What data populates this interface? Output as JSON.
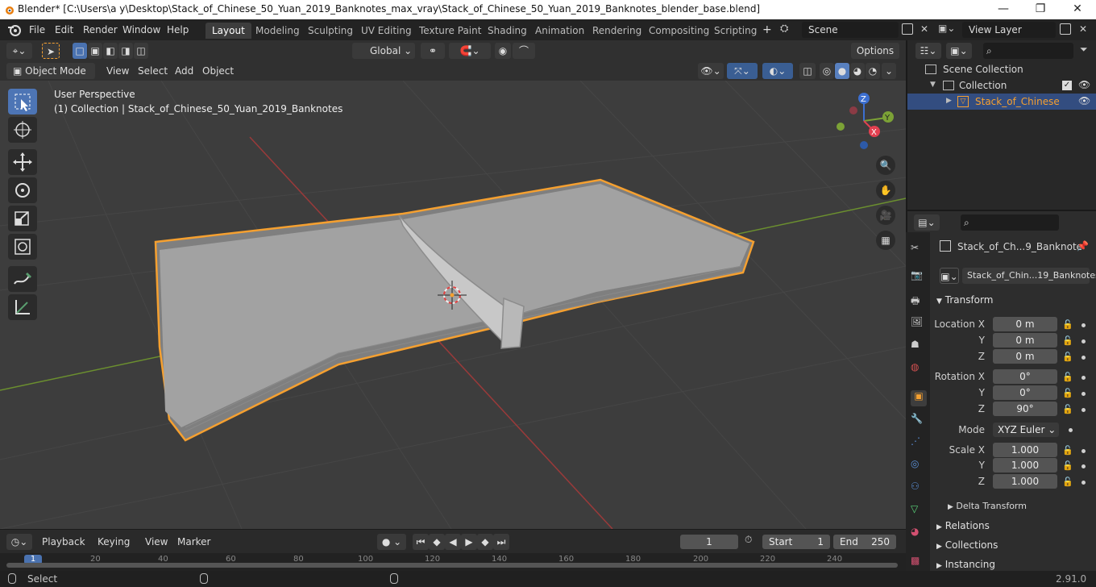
{
  "titlebar": {
    "title": "Blender* [C:\\Users\\a y\\Desktop\\Stack_of_Chinese_50_Yuan_2019_Banknotes_max_vray\\Stack_of_Chinese_50_Yuan_2019_Banknotes_blender_base.blend]",
    "minimize": "—",
    "maximize": "❐",
    "close": "✕"
  },
  "menubar": {
    "menus": [
      "File",
      "Edit",
      "Render",
      "Window",
      "Help"
    ],
    "workspaces": [
      "Layout",
      "Modeling",
      "Sculpting",
      "UV Editing",
      "Texture Paint",
      "Shading",
      "Animation",
      "Rendering",
      "Compositing",
      "Scripting"
    ],
    "add_workspace": "+",
    "scene": "Scene",
    "view_layer": "View Layer"
  },
  "viewport_header": {
    "orientation": "Global",
    "options": "Options",
    "mode": "Object Mode",
    "menus": [
      "View",
      "Select",
      "Add",
      "Object"
    ]
  },
  "viewport": {
    "perspective": "User Perspective",
    "collection_info": "(1) Collection | Stack_of_Chinese_50_Yuan_2019_Banknotes",
    "gizmo": {
      "x": "X",
      "y": "Y",
      "z": "Z"
    }
  },
  "outliner": {
    "scene_collection": "Scene Collection",
    "collection": "Collection",
    "object": "Stack_of_Chinese_50"
  },
  "properties": {
    "object_name": "Stack_of_Ch...9_Banknote",
    "data_name": "Stack_of_Chin...19_Banknotes",
    "transform_label": "Transform",
    "location_label": "Location X",
    "y_label": "Y",
    "z_label": "Z",
    "rotation_label": "Rotation X",
    "mode_label": "Mode",
    "scale_label": "Scale X",
    "location": [
      "0 m",
      "0 m",
      "0 m"
    ],
    "rotation": [
      "0°",
      "0°",
      "90°"
    ],
    "rotation_mode": "XYZ Euler",
    "scale": [
      "1.000",
      "1.000",
      "1.000"
    ],
    "delta_transform": "Delta Transform",
    "relations": "Relations",
    "collections": "Collections",
    "instancing": "Instancing"
  },
  "timeline": {
    "menus": [
      "Playback",
      "Keying",
      "View",
      "Marker"
    ],
    "current_frame": "1",
    "start_label": "Start",
    "start": "1",
    "end_label": "End",
    "end": "250",
    "ticks": [
      "1",
      "20",
      "40",
      "60",
      "80",
      "100",
      "120",
      "140",
      "160",
      "180",
      "200",
      "220",
      "240"
    ]
  },
  "statusbar": {
    "left": "Select",
    "version": "2.91.0"
  },
  "colors": {
    "accent": "#4a72b0",
    "selection_outline": "#f5a030",
    "axis_x": "#b03a3a",
    "axis_y": "#7ca236"
  }
}
